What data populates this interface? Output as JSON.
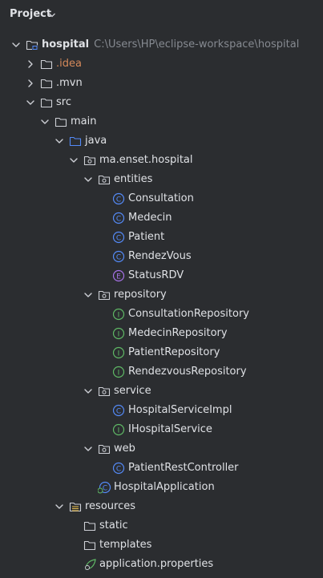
{
  "panel": {
    "title": "Project"
  },
  "tree": [
    {
      "name": "hospital",
      "path": "C:\\Users\\HP\\eclipse-workspace\\hospital",
      "icon": "module-folder-icon",
      "arrow": "down",
      "depth": 0
    },
    {
      "name": ".idea",
      "icon": "folder-icon",
      "arrow": "right",
      "depth": 1,
      "style": "idea"
    },
    {
      "name": ".mvn",
      "icon": "folder-icon",
      "arrow": "right",
      "depth": 1
    },
    {
      "name": "src",
      "icon": "folder-icon",
      "arrow": "down",
      "depth": 1
    },
    {
      "name": "main",
      "icon": "folder-icon",
      "arrow": "down",
      "depth": 2
    },
    {
      "name": "java",
      "icon": "source-folder-icon",
      "arrow": "down",
      "depth": 3
    },
    {
      "name": "ma.enset.hospital",
      "icon": "package-icon",
      "arrow": "down",
      "depth": 4
    },
    {
      "name": "entities",
      "icon": "package-icon",
      "arrow": "down",
      "depth": 5
    },
    {
      "name": "Consultation",
      "icon": "class-icon",
      "depth": 6
    },
    {
      "name": "Medecin",
      "icon": "class-icon",
      "depth": 6
    },
    {
      "name": "Patient",
      "icon": "class-icon",
      "depth": 6
    },
    {
      "name": "RendezVous",
      "icon": "class-icon",
      "depth": 6
    },
    {
      "name": "StatusRDV",
      "icon": "enum-icon",
      "depth": 6
    },
    {
      "name": "repository",
      "icon": "package-icon",
      "arrow": "down",
      "depth": 5
    },
    {
      "name": "ConsultationRepository",
      "icon": "interface-icon",
      "depth": 6
    },
    {
      "name": "MedecinRepository",
      "icon": "interface-icon",
      "depth": 6
    },
    {
      "name": "PatientRepository",
      "icon": "interface-icon",
      "depth": 6
    },
    {
      "name": "RendezvousRepository",
      "icon": "interface-icon",
      "depth": 6
    },
    {
      "name": "service",
      "icon": "package-icon",
      "arrow": "down",
      "depth": 5
    },
    {
      "name": "HospitalServiceImpl",
      "icon": "class-icon",
      "depth": 6
    },
    {
      "name": "IHospitalService",
      "icon": "interface-icon",
      "depth": 6
    },
    {
      "name": "web",
      "icon": "package-icon",
      "arrow": "down",
      "depth": 5
    },
    {
      "name": "PatientRestController",
      "icon": "class-icon",
      "depth": 6
    },
    {
      "name": "HospitalApplication",
      "icon": "spring-class-icon",
      "depth": 5
    },
    {
      "name": "resources",
      "icon": "resources-folder-icon",
      "arrow": "down",
      "depth": 3
    },
    {
      "name": "static",
      "icon": "folder-icon",
      "depth": 4
    },
    {
      "name": "templates",
      "icon": "folder-icon",
      "depth": 4
    },
    {
      "name": "application.properties",
      "icon": "spring-properties-icon",
      "depth": 4
    }
  ],
  "colors": {
    "background": "#2b2d30",
    "text": "#dfe1e5",
    "path_text": "#868a91",
    "excluded_folder": "#d5895a",
    "source_folder": "#548af7",
    "class_icon": "#548af7",
    "interface_icon": "#5fb865",
    "enum_icon": "#a571e6",
    "folder_outline": "#ced0d6"
  }
}
